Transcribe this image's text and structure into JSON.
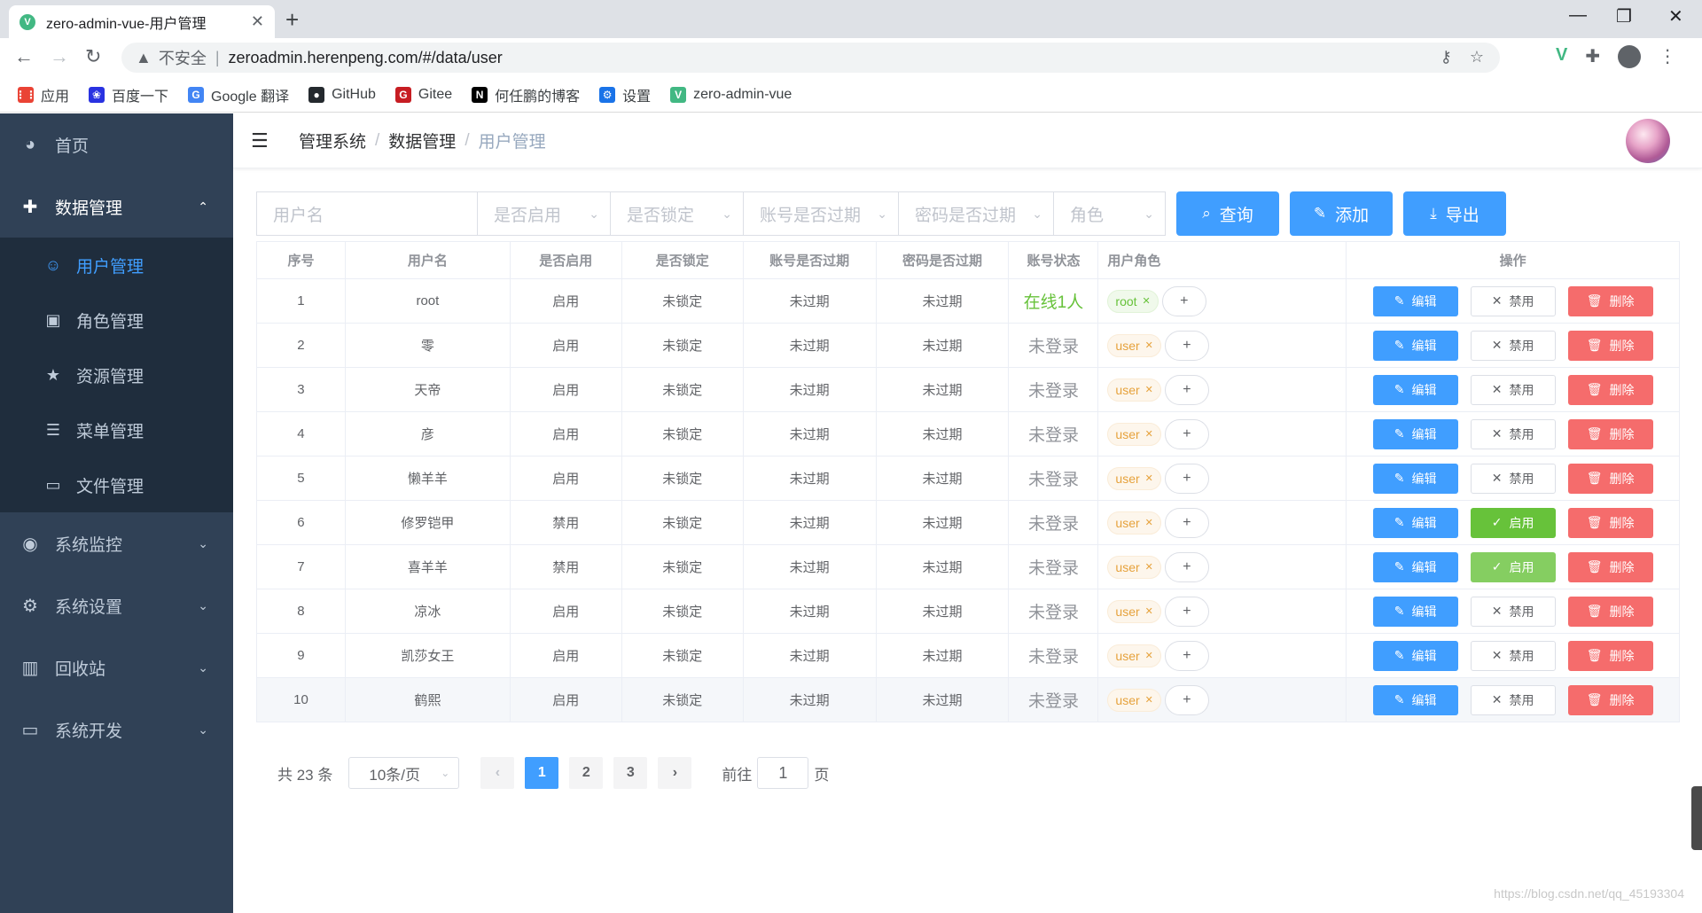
{
  "browser": {
    "tab_title": "zero-admin-vue-用户管理",
    "tab_favicon": "V",
    "new_tab": "+",
    "close": "✕",
    "insecure_label": "不安全",
    "url": "zeroadmin.herenpeng.com/#/data/user",
    "bookmarks": [
      {
        "label": "应用",
        "icon": "apps-grid-icon",
        "glyph": "⋮⋮",
        "color": "#ea4335"
      },
      {
        "label": "百度一下",
        "icon": "baidu-paw-icon",
        "glyph": "❀",
        "color": "#2932e1"
      },
      {
        "label": "Google 翻译",
        "icon": "google-translate-icon",
        "glyph": "G",
        "color": "#4285f4"
      },
      {
        "label": "GitHub",
        "icon": "github-icon",
        "glyph": "●",
        "color": "#24292e"
      },
      {
        "label": "Gitee",
        "icon": "gitee-icon",
        "glyph": "G",
        "color": "#c71d23"
      },
      {
        "label": "何任鹏的博客",
        "icon": "blog-n-icon",
        "glyph": "N",
        "color": "#000000"
      },
      {
        "label": "设置",
        "icon": "settings-gear-icon",
        "glyph": "⚙",
        "color": "#1a73e8"
      },
      {
        "label": "zero-admin-vue",
        "icon": "vue-icon",
        "glyph": "V",
        "color": "#42b883"
      }
    ]
  },
  "sidebar": {
    "items": [
      {
        "label": "首页",
        "icon": "dashboard-icon",
        "glyph": "◕"
      },
      {
        "label": "数据管理",
        "icon": "data-plus-icon",
        "glyph": "✚",
        "arrow": "⌃",
        "expanded": true,
        "children": [
          {
            "label": "用户管理",
            "icon": "user-icon",
            "glyph": "☺",
            "active": true
          },
          {
            "label": "角色管理",
            "icon": "role-badge-icon",
            "glyph": "▣"
          },
          {
            "label": "资源管理",
            "icon": "star-icon",
            "glyph": "★"
          },
          {
            "label": "菜单管理",
            "icon": "menu-tree-icon",
            "glyph": "☰"
          },
          {
            "label": "文件管理",
            "icon": "folder-icon",
            "glyph": "▭"
          }
        ]
      },
      {
        "label": "系统监控",
        "icon": "eye-icon",
        "glyph": "◉",
        "arrow": "⌄"
      },
      {
        "label": "系统设置",
        "icon": "settings-icon",
        "glyph": "⚙",
        "arrow": "⌄"
      },
      {
        "label": "回收站",
        "icon": "trash-icon",
        "glyph": "▥",
        "arrow": "⌄"
      },
      {
        "label": "系统开发",
        "icon": "monitor-icon",
        "glyph": "▭",
        "arrow": "⌄"
      }
    ]
  },
  "breadcrumb": [
    "管理系统",
    "数据管理",
    "用户管理"
  ],
  "filters": {
    "username_placeholder": "用户名",
    "enabled_placeholder": "是否启用",
    "locked_placeholder": "是否锁定",
    "account_expired_placeholder": "账号是否过期",
    "password_expired_placeholder": "密码是否过期",
    "role_placeholder": "角色",
    "query_label": "查询",
    "add_label": "添加",
    "export_label": "导出"
  },
  "table": {
    "headers": [
      "序号",
      "用户名",
      "是否启用",
      "是否锁定",
      "账号是否过期",
      "密码是否过期",
      "账号状态",
      "用户角色",
      "操作"
    ],
    "rows": [
      {
        "idx": "1",
        "name": "root",
        "enabled": "启用",
        "locked": "未锁定",
        "acc": "未过期",
        "pwd": "未过期",
        "status": "在线1人",
        "online": true,
        "role": "root",
        "toggle": "禁用"
      },
      {
        "idx": "2",
        "name": "零",
        "enabled": "启用",
        "locked": "未锁定",
        "acc": "未过期",
        "pwd": "未过期",
        "status": "未登录",
        "online": false,
        "role": "user",
        "toggle": "禁用"
      },
      {
        "idx": "3",
        "name": "天帝",
        "enabled": "启用",
        "locked": "未锁定",
        "acc": "未过期",
        "pwd": "未过期",
        "status": "未登录",
        "online": false,
        "role": "user",
        "toggle": "禁用"
      },
      {
        "idx": "4",
        "name": "彦",
        "enabled": "启用",
        "locked": "未锁定",
        "acc": "未过期",
        "pwd": "未过期",
        "status": "未登录",
        "online": false,
        "role": "user",
        "toggle": "禁用"
      },
      {
        "idx": "5",
        "name": "懒羊羊",
        "enabled": "启用",
        "locked": "未锁定",
        "acc": "未过期",
        "pwd": "未过期",
        "status": "未登录",
        "online": false,
        "role": "user",
        "toggle": "禁用"
      },
      {
        "idx": "6",
        "name": "修罗铠甲",
        "enabled": "禁用",
        "locked": "未锁定",
        "acc": "未过期",
        "pwd": "未过期",
        "status": "未登录",
        "online": false,
        "role": "user",
        "toggle": "启用"
      },
      {
        "idx": "7",
        "name": "喜羊羊",
        "enabled": "禁用",
        "locked": "未锁定",
        "acc": "未过期",
        "pwd": "未过期",
        "status": "未登录",
        "online": false,
        "role": "user",
        "toggle": "启用",
        "light": true
      },
      {
        "idx": "8",
        "name": "凉冰",
        "enabled": "启用",
        "locked": "未锁定",
        "acc": "未过期",
        "pwd": "未过期",
        "status": "未登录",
        "online": false,
        "role": "user",
        "toggle": "禁用"
      },
      {
        "idx": "9",
        "name": "凯莎女王",
        "enabled": "启用",
        "locked": "未锁定",
        "acc": "未过期",
        "pwd": "未过期",
        "status": "未登录",
        "online": false,
        "role": "user",
        "toggle": "禁用"
      },
      {
        "idx": "10",
        "name": "鹤熙",
        "enabled": "启用",
        "locked": "未锁定",
        "acc": "未过期",
        "pwd": "未过期",
        "status": "未登录",
        "online": false,
        "role": "user",
        "toggle": "禁用",
        "highlight": true
      }
    ],
    "edit_label": "编辑",
    "delete_label": "删除",
    "add_role": "+"
  },
  "pagination": {
    "total_text": "共 23 条",
    "page_size": "10条/页",
    "pages": [
      "1",
      "2",
      "3"
    ],
    "current": "1",
    "prev": "‹",
    "next": "›",
    "goto_label": "前往",
    "goto_value": "1",
    "page_suffix": "页"
  },
  "watermark": "https://blog.csdn.net/qq_45193304",
  "colors": {
    "primary": "#409eff",
    "success": "#67c23a",
    "danger": "#f56c6c",
    "warning": "#e6a23c",
    "sidebar": "#304156"
  }
}
